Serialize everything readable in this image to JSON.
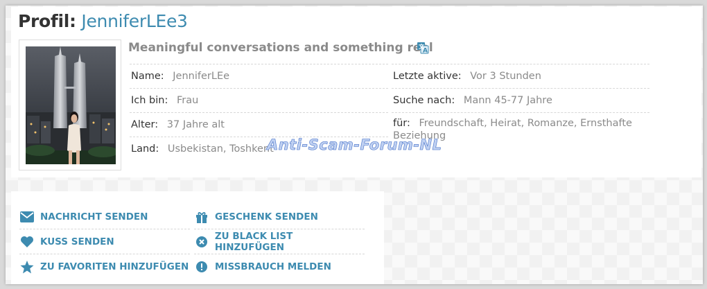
{
  "profile": {
    "title_prefix": "Profil:",
    "username": "JenniferLEe3",
    "headline": "Meaningful conversations and something real",
    "fields_left": [
      {
        "label": "Name:",
        "value": "JenniferLEe"
      },
      {
        "label": "Ich bin:",
        "value": "Frau"
      },
      {
        "label": "Alter:",
        "value": "37 Jahre alt"
      },
      {
        "label": "Land:",
        "value": "Usbekistan, Toshkent"
      }
    ],
    "fields_right": [
      {
        "label": "Letzte aktive:",
        "value": "Vor 3 Stunden"
      },
      {
        "label": "Suche nach:",
        "value": "Mann 45-77 Jahre"
      },
      {
        "label": "für:",
        "value": "Freundschaft, Heirat, Romanze, Ernsthafte Beziehung"
      }
    ]
  },
  "watermark": "Anti-Scam-Forum-NL",
  "actions": [
    {
      "label": "NACHRICHT SENDEN",
      "icon": "envelope-icon"
    },
    {
      "label": "GESCHENK SENDEN",
      "icon": "gift-icon"
    },
    {
      "label": "KUSS SENDEN",
      "icon": "heart-icon"
    },
    {
      "label": "ZU BLACK LIST HINZUFÜGEN",
      "icon": "block-x-icon"
    },
    {
      "label": "ZU FAVORITEN HINZUFÜGEN",
      "icon": "star-icon"
    },
    {
      "label": "MISSBRAUCH MELDEN",
      "icon": "alert-icon"
    }
  ],
  "colors": {
    "accent": "#3d8bb0",
    "label": "#333333",
    "value": "#8a8a8a"
  }
}
